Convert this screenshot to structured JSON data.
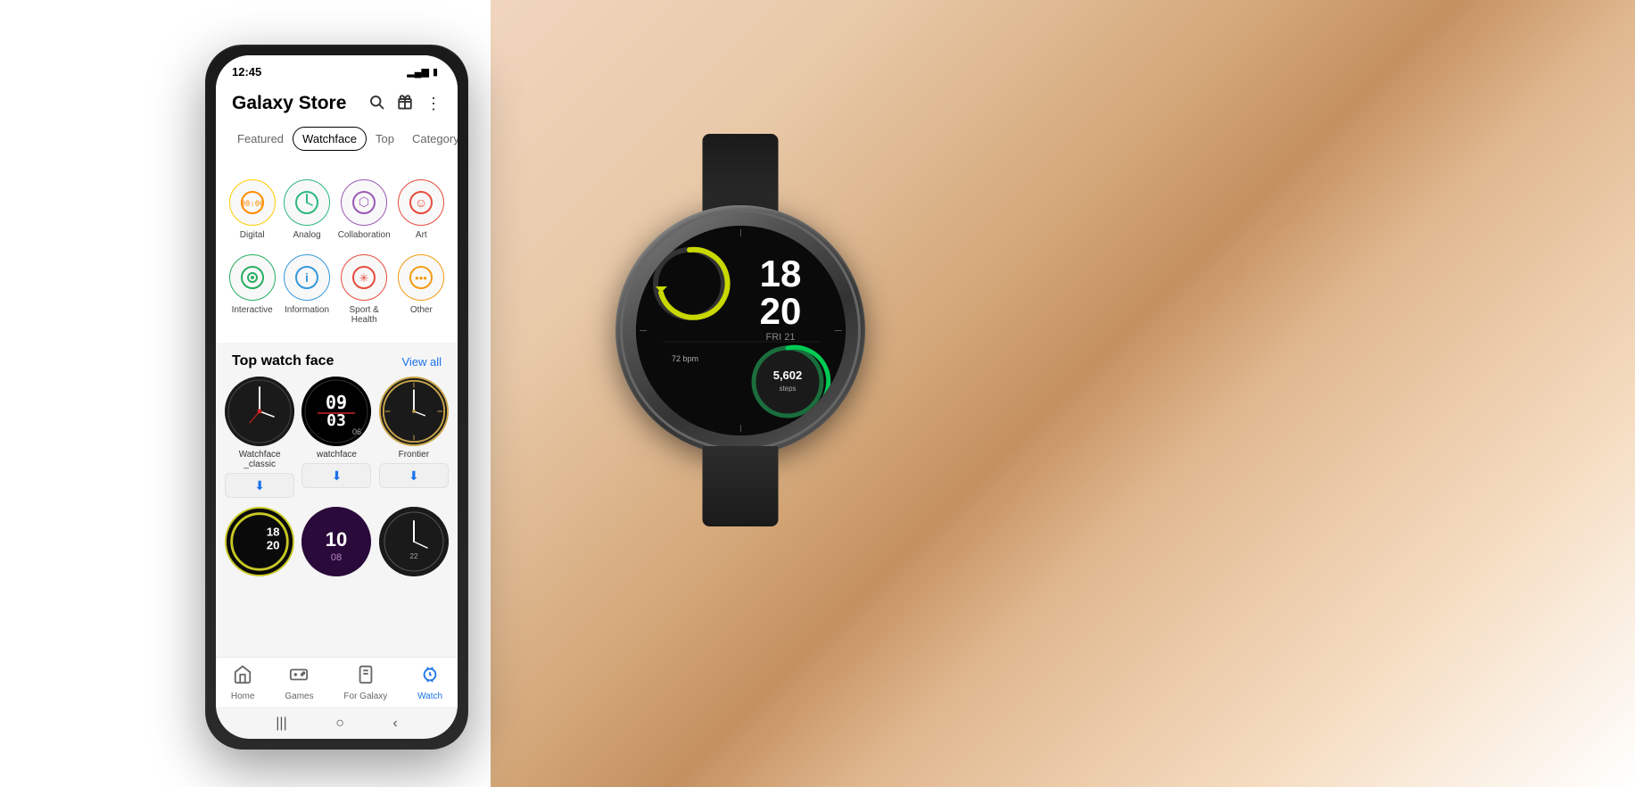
{
  "page": {
    "background": "#ffffff"
  },
  "phone": {
    "status": {
      "time": "12:45",
      "signal_icon": "📶",
      "battery_icon": "🔋"
    },
    "header": {
      "title": "Galaxy Store",
      "search_icon": "search",
      "gift_icon": "gift",
      "more_icon": "more"
    },
    "tabs": [
      {
        "label": "Featured",
        "active": false
      },
      {
        "label": "Watchface",
        "active": true
      },
      {
        "label": "Top",
        "active": false
      },
      {
        "label": "Category",
        "active": false
      }
    ],
    "categories": [
      {
        "label": "Digital",
        "icon": "🕐",
        "color": "#ff6b35"
      },
      {
        "label": "Analog",
        "icon": "🕑",
        "color": "#2db87d"
      },
      {
        "label": "Collaboration",
        "icon": "🔮",
        "color": "#9b59b6"
      },
      {
        "label": "Art",
        "icon": "😊",
        "color": "#e74c3c"
      },
      {
        "label": "Interactive",
        "icon": "🌿",
        "color": "#27ae60"
      },
      {
        "label": "Information",
        "icon": "ℹ️",
        "color": "#3498db"
      },
      {
        "label": "Sport & Health",
        "icon": "❄️",
        "color": "#e74c3c"
      },
      {
        "label": "Other",
        "icon": "⋯",
        "color": "#f39c12"
      }
    ],
    "top_watch_face": {
      "title": "Top watch face",
      "view_all": "View all",
      "items": [
        {
          "name": "Watchface\n_classic",
          "style": "classic"
        },
        {
          "name": "watchface",
          "style": "digital"
        },
        {
          "name": "Frontier",
          "style": "frontier"
        }
      ],
      "row2": [
        {
          "name": "",
          "style": "yellow-accent"
        },
        {
          "name": "",
          "style": "purple-digital"
        },
        {
          "name": "",
          "style": "minimal"
        }
      ]
    },
    "bottom_nav": [
      {
        "label": "Home",
        "icon": "🏠",
        "active": false
      },
      {
        "label": "Games",
        "icon": "🎮",
        "active": false
      },
      {
        "label": "For Galaxy",
        "icon": "📱",
        "active": false
      },
      {
        "label": "Watch",
        "icon": "⌚",
        "active": true
      }
    ]
  },
  "watch": {
    "time": "18",
    "minutes": "20",
    "date": "FRI 21",
    "bpm": "72 bpm",
    "steps": "5,602"
  }
}
